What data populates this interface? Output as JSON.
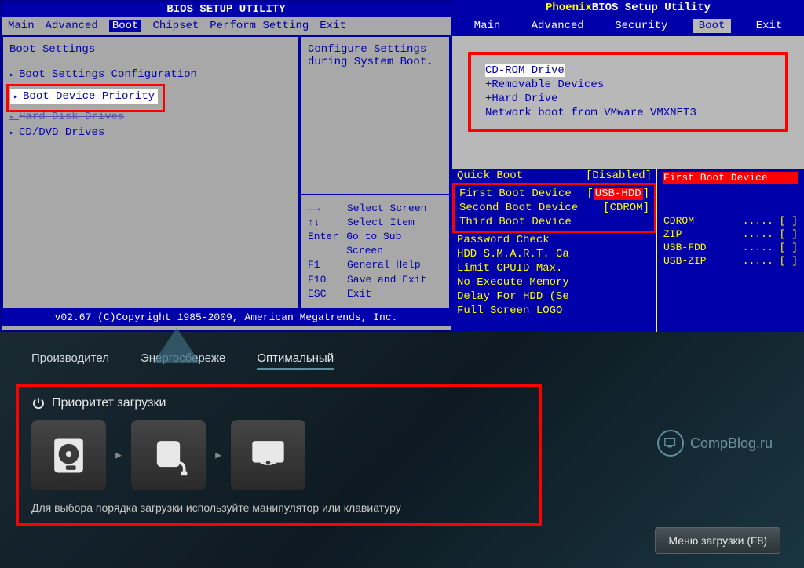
{
  "ami": {
    "title": "BIOS SETUP UTILITY",
    "tabs": [
      "Main",
      "Advanced",
      "Boot",
      "Chipset",
      "Perform Setting",
      "Exit"
    ],
    "active_tab": "Boot",
    "section_title": "Boot Settings",
    "items": [
      "Boot Settings Configuration",
      "Boot Device Priority",
      "Hard Disk Drives",
      "CD/DVD Drives"
    ],
    "help_text": "Configure Settings during System Boot.",
    "keys": [
      {
        "key": "←→",
        "desc": "Select Screen"
      },
      {
        "key": "↑↓",
        "desc": "Select Item"
      },
      {
        "key": "Enter",
        "desc": "Go to Sub Screen"
      },
      {
        "key": "F1",
        "desc": "General Help"
      },
      {
        "key": "F10",
        "desc": "Save and Exit"
      },
      {
        "key": "ESC",
        "desc": "Exit"
      }
    ],
    "footer": "v02.67 (C)Copyright 1985-2009, American Megatrends, Inc."
  },
  "phoenix": {
    "title_brand": "Phoenix",
    "title_rest": "BIOS Setup Utility",
    "tabs": [
      "Main",
      "Advanced",
      "Security",
      "Boot",
      "Exit"
    ],
    "active_tab": "Boot",
    "boot_items": [
      "CD-ROM Drive",
      "+Removable Devices",
      "+Hard Drive",
      "Network boot from VMware VMXNET3"
    ]
  },
  "award": {
    "left_items": [
      {
        "label": "Quick Boot",
        "value": "[Disabled]"
      },
      {
        "label": "First Boot Device",
        "value": "USB-HDD",
        "highlighted": true
      },
      {
        "label": "Second Boot Device",
        "value": "[CDROM]"
      },
      {
        "label": "Third Boot Device",
        "value": ""
      },
      {
        "label": "Password Check",
        "value": ""
      },
      {
        "label": "HDD S.M.A.R.T. Ca",
        "value": ""
      },
      {
        "label": "Limit CPUID Max.",
        "value": ""
      },
      {
        "label": "No-Execute Memory",
        "value": ""
      },
      {
        "label": "Delay For HDD (Se",
        "value": ""
      },
      {
        "label": "Full Screen LOGO",
        "value": ""
      }
    ],
    "right_heading": "First Boot Device",
    "right_options": [
      "CDROM",
      "ZIP",
      "USB-FDD",
      "USB-ZIP"
    ]
  },
  "efi": {
    "tabs": [
      "Производител",
      "Энергосбереже",
      "Оптимальный"
    ],
    "priority_title": "Приоритет загрузки",
    "hint": "Для выбора порядка загрузки используйте манипулятор или клавиатуру",
    "menu_button": "Меню загрузки (F8)",
    "logo_text": "CompBlog.ru"
  }
}
